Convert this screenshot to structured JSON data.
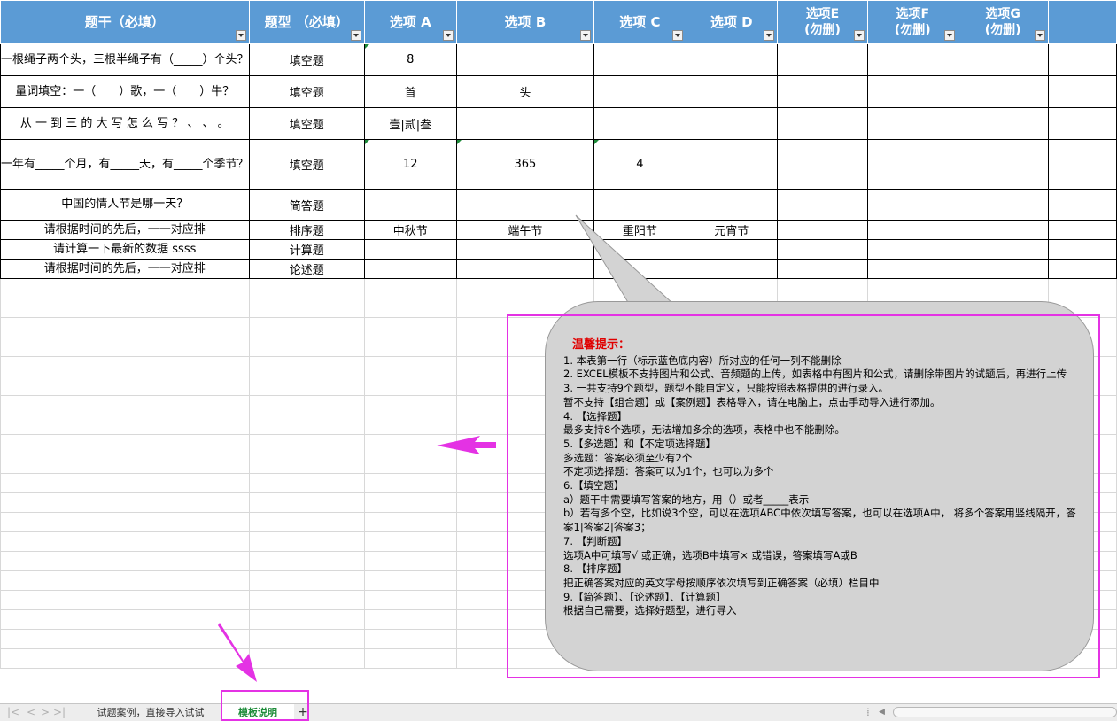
{
  "header": {
    "stem": "题干（必填）",
    "type": "题型 （必填）",
    "optA": "选项 A",
    "optB": "选项 B",
    "optC": "选项 C",
    "optD": "选项 D",
    "optE1": "选项E",
    "optE2": "(勿删)",
    "optF1": "选项F",
    "optF2": "(勿删)",
    "optG1": "选项G",
    "optG2": "(勿删)"
  },
  "rows": [
    {
      "stem": "一根绳子两个头，三根半绳子有（_____）个头？",
      "type": "填空题",
      "a": "8",
      "b": "",
      "c": "",
      "d": ""
    },
    {
      "stem": "量词填空：一（　　）歌，一（　　）牛？",
      "type": "填空题",
      "a": "首",
      "b": "头",
      "c": "",
      "d": ""
    },
    {
      "stem": "从 一 到 三 的 大 写 怎 么 写 ？ 、 、 。",
      "type": "填空题",
      "a": "壹|贰|叁",
      "b": "",
      "c": "",
      "d": ""
    },
    {
      "stem": "一年有_____个月，有_____天，有_____个季节？",
      "type": "填空题",
      "a": "12",
      "b": "365",
      "c": "4",
      "d": ""
    },
    {
      "stem": "中国的情人节是哪一天？",
      "type": "简答题",
      "a": "",
      "b": "",
      "c": "",
      "d": ""
    },
    {
      "stem": "请根据时间的先后，一一对应排",
      "type": "排序题",
      "a": "中秋节",
      "b": "端午节",
      "c": "重阳节",
      "d": "元宵节"
    },
    {
      "stem": "请计算一下最新的数据 ssss",
      "type": "计算题",
      "a": "",
      "b": "",
      "c": "",
      "d": ""
    },
    {
      "stem": "请根据时间的先后，一一对应排",
      "type": "论述题",
      "a": "",
      "b": "",
      "c": "",
      "d": ""
    }
  ],
  "note": {
    "title": "温馨提示：",
    "lines": [
      "1. 本表第一行（标示蓝色底内容）所对应的任何一列不能删除",
      "2. EXCEL模板不支持图片和公式、音频题的上传，如表格中有图片和公式，请删除带图片的试题后，再进行上传",
      "3. 一共支持9个题型，题型不能自定义，只能按照表格提供的进行录入。",
      "暂不支持【组合题】或【案例题】表格导入，请在电脑上，点击手动导入进行添加。",
      "4. 【选择题】",
      "最多支持8个选项，无法增加多余的选项，表格中也不能删除。",
      "5.【多选题】和【不定项选择题】",
      "多选题：答案必须至少有2个",
      "不定项选择题：答案可以为1个，也可以为多个",
      "6.【填空题】",
      " a）题干中需要填写答案的地方，用（）或者_____表示",
      " b）若有多个空，比如说3个空，可以在选项ABC中依次填写答案，也可以在选项A中， 将多个答案用竖线隔开，答案1|答案2|答案3；",
      "7. 【判断题】",
      "选项A中可填写√ 或正确，选项B中填写× 或错误，答案填写A或B",
      "8. 【排序题】",
      "把正确答案对应的英文字母按顺序依次填写到正确答案（必填）栏目中",
      "9.【简答题】、【论述题】、【计算题】",
      "根据自己需要，选择好题型，进行导入"
    ]
  },
  "tabs": {
    "sheet1": "试题案例，直接导入试试",
    "sheet2": "模板说明",
    "add": "+"
  },
  "nav": {
    "first": "|<",
    "prev": "<",
    "next": ">",
    "last": ">|"
  },
  "colors": {
    "header": "#5b9bd5",
    "highlight": "#e432e4",
    "active_tab": "#1e8c3a",
    "note_title": "#e00000"
  }
}
